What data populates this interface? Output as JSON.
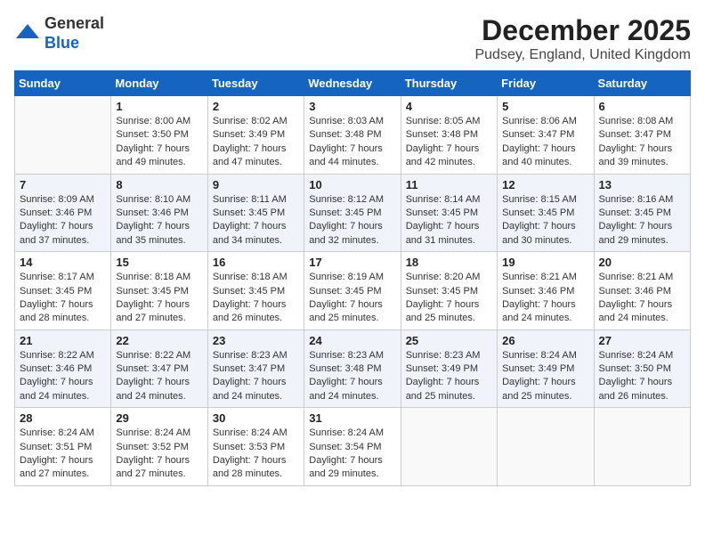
{
  "logo": {
    "general": "General",
    "blue": "Blue"
  },
  "title": "December 2025",
  "location": "Pudsey, England, United Kingdom",
  "days_header": [
    "Sunday",
    "Monday",
    "Tuesday",
    "Wednesday",
    "Thursday",
    "Friday",
    "Saturday"
  ],
  "weeks": [
    [
      {
        "day": "",
        "info": ""
      },
      {
        "day": "1",
        "info": "Sunrise: 8:00 AM\nSunset: 3:50 PM\nDaylight: 7 hours\nand 49 minutes."
      },
      {
        "day": "2",
        "info": "Sunrise: 8:02 AM\nSunset: 3:49 PM\nDaylight: 7 hours\nand 47 minutes."
      },
      {
        "day": "3",
        "info": "Sunrise: 8:03 AM\nSunset: 3:48 PM\nDaylight: 7 hours\nand 44 minutes."
      },
      {
        "day": "4",
        "info": "Sunrise: 8:05 AM\nSunset: 3:48 PM\nDaylight: 7 hours\nand 42 minutes."
      },
      {
        "day": "5",
        "info": "Sunrise: 8:06 AM\nSunset: 3:47 PM\nDaylight: 7 hours\nand 40 minutes."
      },
      {
        "day": "6",
        "info": "Sunrise: 8:08 AM\nSunset: 3:47 PM\nDaylight: 7 hours\nand 39 minutes."
      }
    ],
    [
      {
        "day": "7",
        "info": "Sunrise: 8:09 AM\nSunset: 3:46 PM\nDaylight: 7 hours\nand 37 minutes."
      },
      {
        "day": "8",
        "info": "Sunrise: 8:10 AM\nSunset: 3:46 PM\nDaylight: 7 hours\nand 35 minutes."
      },
      {
        "day": "9",
        "info": "Sunrise: 8:11 AM\nSunset: 3:45 PM\nDaylight: 7 hours\nand 34 minutes."
      },
      {
        "day": "10",
        "info": "Sunrise: 8:12 AM\nSunset: 3:45 PM\nDaylight: 7 hours\nand 32 minutes."
      },
      {
        "day": "11",
        "info": "Sunrise: 8:14 AM\nSunset: 3:45 PM\nDaylight: 7 hours\nand 31 minutes."
      },
      {
        "day": "12",
        "info": "Sunrise: 8:15 AM\nSunset: 3:45 PM\nDaylight: 7 hours\nand 30 minutes."
      },
      {
        "day": "13",
        "info": "Sunrise: 8:16 AM\nSunset: 3:45 PM\nDaylight: 7 hours\nand 29 minutes."
      }
    ],
    [
      {
        "day": "14",
        "info": "Sunrise: 8:17 AM\nSunset: 3:45 PM\nDaylight: 7 hours\nand 28 minutes."
      },
      {
        "day": "15",
        "info": "Sunrise: 8:18 AM\nSunset: 3:45 PM\nDaylight: 7 hours\nand 27 minutes."
      },
      {
        "day": "16",
        "info": "Sunrise: 8:18 AM\nSunset: 3:45 PM\nDaylight: 7 hours\nand 26 minutes."
      },
      {
        "day": "17",
        "info": "Sunrise: 8:19 AM\nSunset: 3:45 PM\nDaylight: 7 hours\nand 25 minutes."
      },
      {
        "day": "18",
        "info": "Sunrise: 8:20 AM\nSunset: 3:45 PM\nDaylight: 7 hours\nand 25 minutes."
      },
      {
        "day": "19",
        "info": "Sunrise: 8:21 AM\nSunset: 3:46 PM\nDaylight: 7 hours\nand 24 minutes."
      },
      {
        "day": "20",
        "info": "Sunrise: 8:21 AM\nSunset: 3:46 PM\nDaylight: 7 hours\nand 24 minutes."
      }
    ],
    [
      {
        "day": "21",
        "info": "Sunrise: 8:22 AM\nSunset: 3:46 PM\nDaylight: 7 hours\nand 24 minutes."
      },
      {
        "day": "22",
        "info": "Sunrise: 8:22 AM\nSunset: 3:47 PM\nDaylight: 7 hours\nand 24 minutes."
      },
      {
        "day": "23",
        "info": "Sunrise: 8:23 AM\nSunset: 3:47 PM\nDaylight: 7 hours\nand 24 minutes."
      },
      {
        "day": "24",
        "info": "Sunrise: 8:23 AM\nSunset: 3:48 PM\nDaylight: 7 hours\nand 24 minutes."
      },
      {
        "day": "25",
        "info": "Sunrise: 8:23 AM\nSunset: 3:49 PM\nDaylight: 7 hours\nand 25 minutes."
      },
      {
        "day": "26",
        "info": "Sunrise: 8:24 AM\nSunset: 3:49 PM\nDaylight: 7 hours\nand 25 minutes."
      },
      {
        "day": "27",
        "info": "Sunrise: 8:24 AM\nSunset: 3:50 PM\nDaylight: 7 hours\nand 26 minutes."
      }
    ],
    [
      {
        "day": "28",
        "info": "Sunrise: 8:24 AM\nSunset: 3:51 PM\nDaylight: 7 hours\nand 27 minutes."
      },
      {
        "day": "29",
        "info": "Sunrise: 8:24 AM\nSunset: 3:52 PM\nDaylight: 7 hours\nand 27 minutes."
      },
      {
        "day": "30",
        "info": "Sunrise: 8:24 AM\nSunset: 3:53 PM\nDaylight: 7 hours\nand 28 minutes."
      },
      {
        "day": "31",
        "info": "Sunrise: 8:24 AM\nSunset: 3:54 PM\nDaylight: 7 hours\nand 29 minutes."
      },
      {
        "day": "",
        "info": ""
      },
      {
        "day": "",
        "info": ""
      },
      {
        "day": "",
        "info": ""
      }
    ]
  ]
}
